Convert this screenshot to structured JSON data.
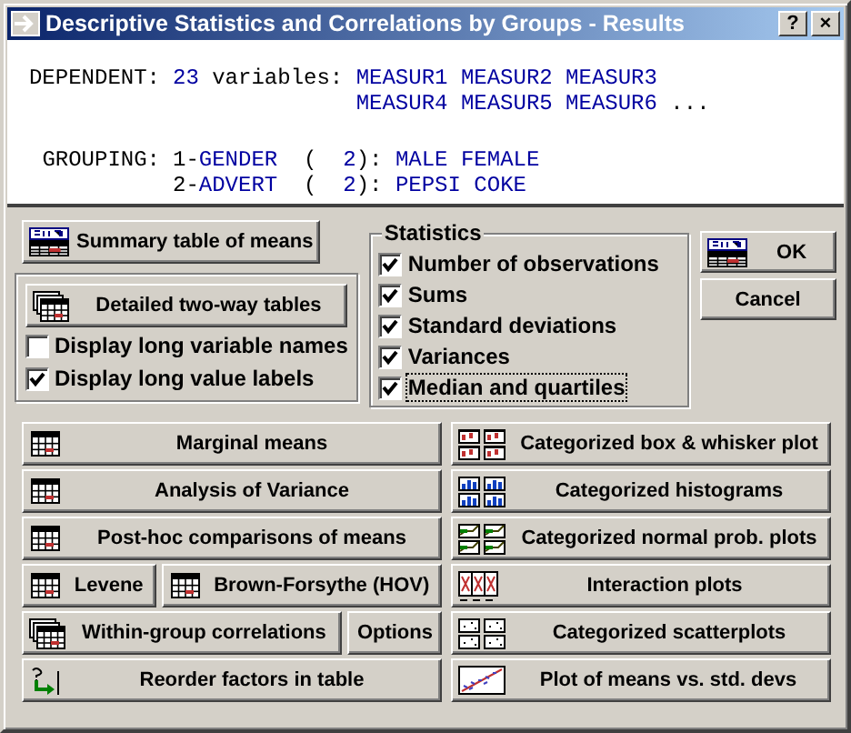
{
  "window": {
    "title": "Descriptive Statistics and Correlations by Groups - Results",
    "controls": [
      "?",
      "×"
    ]
  },
  "info": {
    "dependent": {
      "label": "DEPENDENT:",
      "count": "23",
      "unit": "variables:",
      "lines": [
        "MEASUR1 MEASUR2 MEASUR3",
        "MEASUR4 MEASUR5 MEASUR6"
      ],
      "more": "..."
    },
    "grouping": {
      "label": "GROUPING:",
      "factors": [
        {
          "index": "1-",
          "name": "GENDER",
          "open": "(",
          "count": "2",
          "close": "):",
          "values": "MALE FEMALE"
        },
        {
          "index": "2-",
          "name": "ADVERT",
          "open": "(",
          "count": "2",
          "close": "):",
          "values": "PEPSI COKE"
        }
      ]
    }
  },
  "summary_button": {
    "label": "Summary table of means",
    "kind": "summary"
  },
  "detail_group": {
    "button": {
      "label": "Detailed two-way tables",
      "kind": "stack"
    },
    "options": [
      {
        "label": "Display long variable names",
        "checked": false
      },
      {
        "label": "Display long value labels",
        "checked": true
      }
    ]
  },
  "statistics": {
    "title": "Statistics",
    "options": [
      {
        "label": "Number of observations",
        "checked": true,
        "focused": false
      },
      {
        "label": "Sums",
        "checked": true,
        "focused": false
      },
      {
        "label": "Standard deviations",
        "checked": true,
        "focused": false
      },
      {
        "label": "Variances",
        "checked": true,
        "focused": false
      },
      {
        "label": "Median and quartiles",
        "checked": true,
        "focused": true
      }
    ]
  },
  "dialog_buttons": [
    {
      "label": "OK",
      "kind": "summary"
    },
    {
      "label": "Cancel",
      "kind": "plain"
    }
  ],
  "left_rows": [
    [
      {
        "label": "Marginal means",
        "kind": "table"
      }
    ],
    [
      {
        "label": "Analysis of Variance",
        "kind": "table"
      }
    ],
    [
      {
        "label": "Post-hoc comparisons of means",
        "kind": "table"
      }
    ],
    [
      {
        "label": "Levene",
        "kind": "table"
      },
      {
        "label": "Brown-Forsythe (HOV)",
        "kind": "table"
      }
    ],
    [
      {
        "label": "Within-group correlations",
        "kind": "stack"
      },
      {
        "label": "Options",
        "kind": "plain"
      }
    ],
    [
      {
        "label": "Reorder factors in table",
        "kind": "reorder"
      }
    ]
  ],
  "right_buttons": [
    {
      "label": "Categorized box & whisker plot",
      "kind": "boxplot"
    },
    {
      "label": "Categorized histograms",
      "kind": "histogram"
    },
    {
      "label": "Categorized normal prob. plots",
      "kind": "normal"
    },
    {
      "label": "Interaction plots",
      "kind": "interaction"
    },
    {
      "label": "Categorized scatterplots",
      "kind": "scatter"
    },
    {
      "label": "Plot of means vs. std. devs",
      "kind": "meansplot"
    }
  ]
}
